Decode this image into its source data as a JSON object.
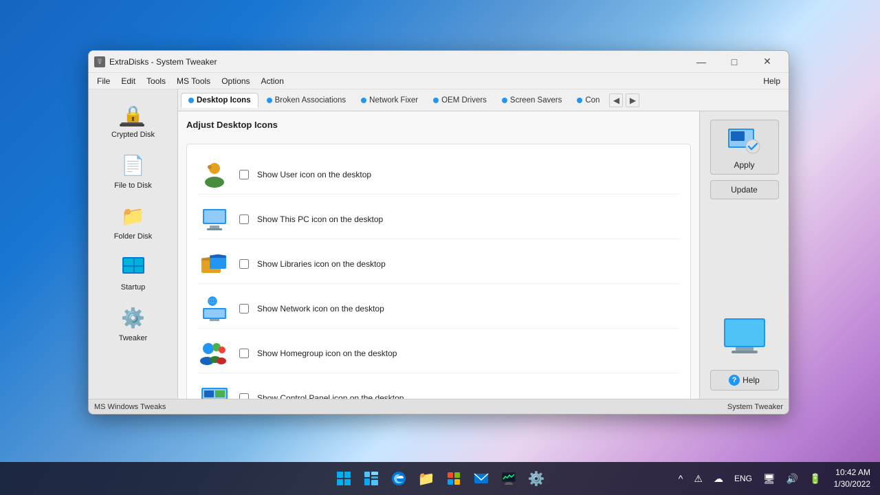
{
  "window": {
    "title": "ExtraDisks - System Tweaker",
    "titleIcon": "■"
  },
  "menubar": {
    "items": [
      "File",
      "Edit",
      "Tools",
      "MS Tools",
      "Options",
      "Action"
    ],
    "help": "Help"
  },
  "sidebar": {
    "items": [
      {
        "id": "crypted-disk",
        "label": "Crypted Disk",
        "icon": "🔒"
      },
      {
        "id": "file-to-disk",
        "label": "File to Disk",
        "icon": "📄"
      },
      {
        "id": "folder-disk",
        "label": "Folder Disk",
        "icon": "📁"
      },
      {
        "id": "startup",
        "label": "Startup",
        "icon": "⊞"
      },
      {
        "id": "tweaker",
        "label": "Tweaker",
        "icon": "⚙"
      }
    ]
  },
  "tabs": {
    "items": [
      {
        "id": "desktop-icons",
        "label": "Desktop Icons",
        "active": true
      },
      {
        "id": "broken-associations",
        "label": "Broken Associations",
        "active": false
      },
      {
        "id": "network-fixer",
        "label": "Network Fixer",
        "active": false
      },
      {
        "id": "oem-drivers",
        "label": "OEM Drivers",
        "active": false
      },
      {
        "id": "screen-savers",
        "label": "Screen Savers",
        "active": false
      },
      {
        "id": "con",
        "label": "Con",
        "active": false
      }
    ],
    "nav_prev": "◀",
    "nav_next": "▶"
  },
  "panel": {
    "title": "Adjust Desktop Icons",
    "checkboxes": [
      {
        "id": "user-icon",
        "label": "Show User icon on the desktop",
        "checked": false,
        "icon": "👤"
      },
      {
        "id": "thispc-icon",
        "label": "Show This PC icon on the desktop",
        "checked": false,
        "icon": "💻"
      },
      {
        "id": "libraries-icon",
        "label": "Show Libraries icon on the desktop",
        "checked": false,
        "icon": "📂"
      },
      {
        "id": "network-icon",
        "label": "Show Network icon on the desktop",
        "checked": false,
        "icon": "🌐"
      },
      {
        "id": "homegroup-icon",
        "label": "Show Homegroup icon on the desktop",
        "checked": false,
        "icon": "👥"
      },
      {
        "id": "controlpanel-icon",
        "label": "Show Control Panel icon on the desktop",
        "checked": false,
        "icon": "🖥"
      }
    ]
  },
  "right_panel": {
    "apply_label": "Apply",
    "update_label": "Update",
    "help_label": "Help",
    "monitor_icon": "🖥",
    "question_icon": "?"
  },
  "statusbar": {
    "left": "MS Windows Tweaks",
    "right": "System Tweaker"
  },
  "taskbar": {
    "icons": [
      {
        "id": "start",
        "icon": "⊞",
        "label": "Start"
      },
      {
        "id": "widgets",
        "icon": "▦",
        "label": "Widgets"
      },
      {
        "id": "edge",
        "icon": "🌐",
        "label": "Edge"
      },
      {
        "id": "files",
        "icon": "📁",
        "label": "Files"
      },
      {
        "id": "store",
        "icon": "🛍",
        "label": "Store"
      },
      {
        "id": "mail",
        "icon": "✉",
        "label": "Mail"
      },
      {
        "id": "monitor",
        "icon": "📊",
        "label": "Monitor"
      },
      {
        "id": "settings",
        "icon": "⚙",
        "label": "Settings"
      }
    ],
    "tray": {
      "chevron": "^",
      "warning": "⚠",
      "cloud": "☁",
      "lang": "ENG",
      "display": "🖥",
      "sound": "🔊",
      "battery": "🔋"
    },
    "clock": {
      "time": "10:42 AM",
      "date": "1/30/2022"
    }
  }
}
